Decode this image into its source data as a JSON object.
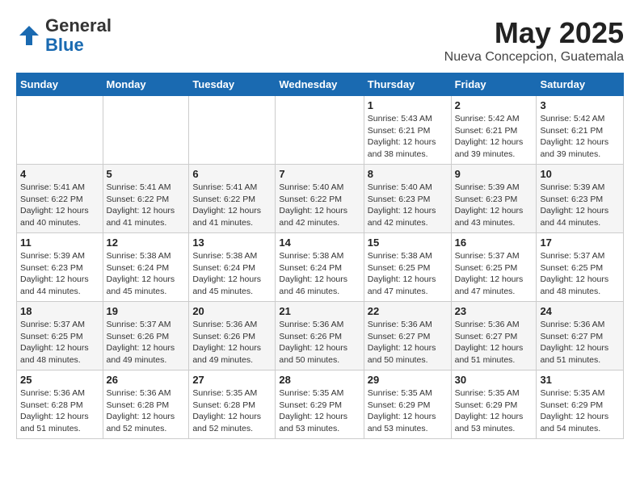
{
  "logo": {
    "general": "General",
    "blue": "Blue"
  },
  "title": "May 2025",
  "location": "Nueva Concepcion, Guatemala",
  "days_of_week": [
    "Sunday",
    "Monday",
    "Tuesday",
    "Wednesday",
    "Thursday",
    "Friday",
    "Saturday"
  ],
  "weeks": [
    [
      {
        "day": "",
        "info": ""
      },
      {
        "day": "",
        "info": ""
      },
      {
        "day": "",
        "info": ""
      },
      {
        "day": "",
        "info": ""
      },
      {
        "day": "1",
        "info": "Sunrise: 5:43 AM\nSunset: 6:21 PM\nDaylight: 12 hours\nand 38 minutes."
      },
      {
        "day": "2",
        "info": "Sunrise: 5:42 AM\nSunset: 6:21 PM\nDaylight: 12 hours\nand 39 minutes."
      },
      {
        "day": "3",
        "info": "Sunrise: 5:42 AM\nSunset: 6:21 PM\nDaylight: 12 hours\nand 39 minutes."
      }
    ],
    [
      {
        "day": "4",
        "info": "Sunrise: 5:41 AM\nSunset: 6:22 PM\nDaylight: 12 hours\nand 40 minutes."
      },
      {
        "day": "5",
        "info": "Sunrise: 5:41 AM\nSunset: 6:22 PM\nDaylight: 12 hours\nand 41 minutes."
      },
      {
        "day": "6",
        "info": "Sunrise: 5:41 AM\nSunset: 6:22 PM\nDaylight: 12 hours\nand 41 minutes."
      },
      {
        "day": "7",
        "info": "Sunrise: 5:40 AM\nSunset: 6:22 PM\nDaylight: 12 hours\nand 42 minutes."
      },
      {
        "day": "8",
        "info": "Sunrise: 5:40 AM\nSunset: 6:23 PM\nDaylight: 12 hours\nand 42 minutes."
      },
      {
        "day": "9",
        "info": "Sunrise: 5:39 AM\nSunset: 6:23 PM\nDaylight: 12 hours\nand 43 minutes."
      },
      {
        "day": "10",
        "info": "Sunrise: 5:39 AM\nSunset: 6:23 PM\nDaylight: 12 hours\nand 44 minutes."
      }
    ],
    [
      {
        "day": "11",
        "info": "Sunrise: 5:39 AM\nSunset: 6:23 PM\nDaylight: 12 hours\nand 44 minutes."
      },
      {
        "day": "12",
        "info": "Sunrise: 5:38 AM\nSunset: 6:24 PM\nDaylight: 12 hours\nand 45 minutes."
      },
      {
        "day": "13",
        "info": "Sunrise: 5:38 AM\nSunset: 6:24 PM\nDaylight: 12 hours\nand 45 minutes."
      },
      {
        "day": "14",
        "info": "Sunrise: 5:38 AM\nSunset: 6:24 PM\nDaylight: 12 hours\nand 46 minutes."
      },
      {
        "day": "15",
        "info": "Sunrise: 5:38 AM\nSunset: 6:25 PM\nDaylight: 12 hours\nand 47 minutes."
      },
      {
        "day": "16",
        "info": "Sunrise: 5:37 AM\nSunset: 6:25 PM\nDaylight: 12 hours\nand 47 minutes."
      },
      {
        "day": "17",
        "info": "Sunrise: 5:37 AM\nSunset: 6:25 PM\nDaylight: 12 hours\nand 48 minutes."
      }
    ],
    [
      {
        "day": "18",
        "info": "Sunrise: 5:37 AM\nSunset: 6:25 PM\nDaylight: 12 hours\nand 48 minutes."
      },
      {
        "day": "19",
        "info": "Sunrise: 5:37 AM\nSunset: 6:26 PM\nDaylight: 12 hours\nand 49 minutes."
      },
      {
        "day": "20",
        "info": "Sunrise: 5:36 AM\nSunset: 6:26 PM\nDaylight: 12 hours\nand 49 minutes."
      },
      {
        "day": "21",
        "info": "Sunrise: 5:36 AM\nSunset: 6:26 PM\nDaylight: 12 hours\nand 50 minutes."
      },
      {
        "day": "22",
        "info": "Sunrise: 5:36 AM\nSunset: 6:27 PM\nDaylight: 12 hours\nand 50 minutes."
      },
      {
        "day": "23",
        "info": "Sunrise: 5:36 AM\nSunset: 6:27 PM\nDaylight: 12 hours\nand 51 minutes."
      },
      {
        "day": "24",
        "info": "Sunrise: 5:36 AM\nSunset: 6:27 PM\nDaylight: 12 hours\nand 51 minutes."
      }
    ],
    [
      {
        "day": "25",
        "info": "Sunrise: 5:36 AM\nSunset: 6:28 PM\nDaylight: 12 hours\nand 51 minutes."
      },
      {
        "day": "26",
        "info": "Sunrise: 5:36 AM\nSunset: 6:28 PM\nDaylight: 12 hours\nand 52 minutes."
      },
      {
        "day": "27",
        "info": "Sunrise: 5:35 AM\nSunset: 6:28 PM\nDaylight: 12 hours\nand 52 minutes."
      },
      {
        "day": "28",
        "info": "Sunrise: 5:35 AM\nSunset: 6:29 PM\nDaylight: 12 hours\nand 53 minutes."
      },
      {
        "day": "29",
        "info": "Sunrise: 5:35 AM\nSunset: 6:29 PM\nDaylight: 12 hours\nand 53 minutes."
      },
      {
        "day": "30",
        "info": "Sunrise: 5:35 AM\nSunset: 6:29 PM\nDaylight: 12 hours\nand 53 minutes."
      },
      {
        "day": "31",
        "info": "Sunrise: 5:35 AM\nSunset: 6:29 PM\nDaylight: 12 hours\nand 54 minutes."
      }
    ]
  ]
}
